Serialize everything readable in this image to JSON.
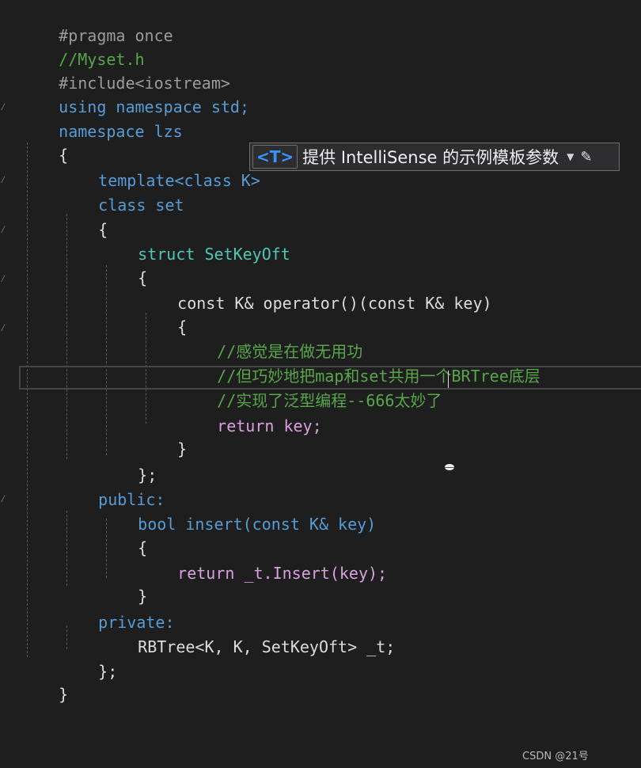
{
  "code_lines": [
    {
      "text": "#pragma once"
    },
    {
      "text": "//Myset.h"
    },
    {
      "text": "#include<iostream>"
    },
    {
      "text": "using namespace std;"
    },
    {
      "text": "namespace lzs"
    },
    {
      "text": "{"
    },
    {
      "text": "template<class K>"
    },
    {
      "text": "class set"
    },
    {
      "text": "{"
    },
    {
      "text": "struct SetKeyOft"
    },
    {
      "text": "{"
    },
    {
      "text": "const K& operator()(const K& key)"
    },
    {
      "text": "{"
    },
    {
      "text": "//感觉是在做无用功"
    },
    {
      "text": "//但巧妙地把map和set共用一个BRTree底层"
    },
    {
      "text": "//实现了泛型编程--666太妙了"
    },
    {
      "text": "return key;"
    },
    {
      "text": "}"
    },
    {
      "text": "};"
    },
    {
      "text": "public:"
    },
    {
      "text": "bool insert(const K& key)"
    },
    {
      "text": "{"
    },
    {
      "text": "return _t.Insert(key);"
    },
    {
      "text": "}"
    },
    {
      "text": "private:"
    },
    {
      "text": "RBTree<K, K, SetKeyOft> _t;"
    },
    {
      "text": "};"
    },
    {
      "text": "}"
    }
  ],
  "template_hint": {
    "badge": "<T>",
    "text": "提供 IntelliSense 的示例模板参数",
    "dropdown_icon": "chevron-down-icon",
    "edit_icon": "pencil-icon"
  },
  "watermark": "CSDN @21号",
  "colors": {
    "background": "#1e1e1e",
    "keyword": "#569cd6",
    "type": "#4ec9b0",
    "comment": "#57a64a",
    "control": "#d8a0df",
    "text": "#dcdcdc"
  }
}
